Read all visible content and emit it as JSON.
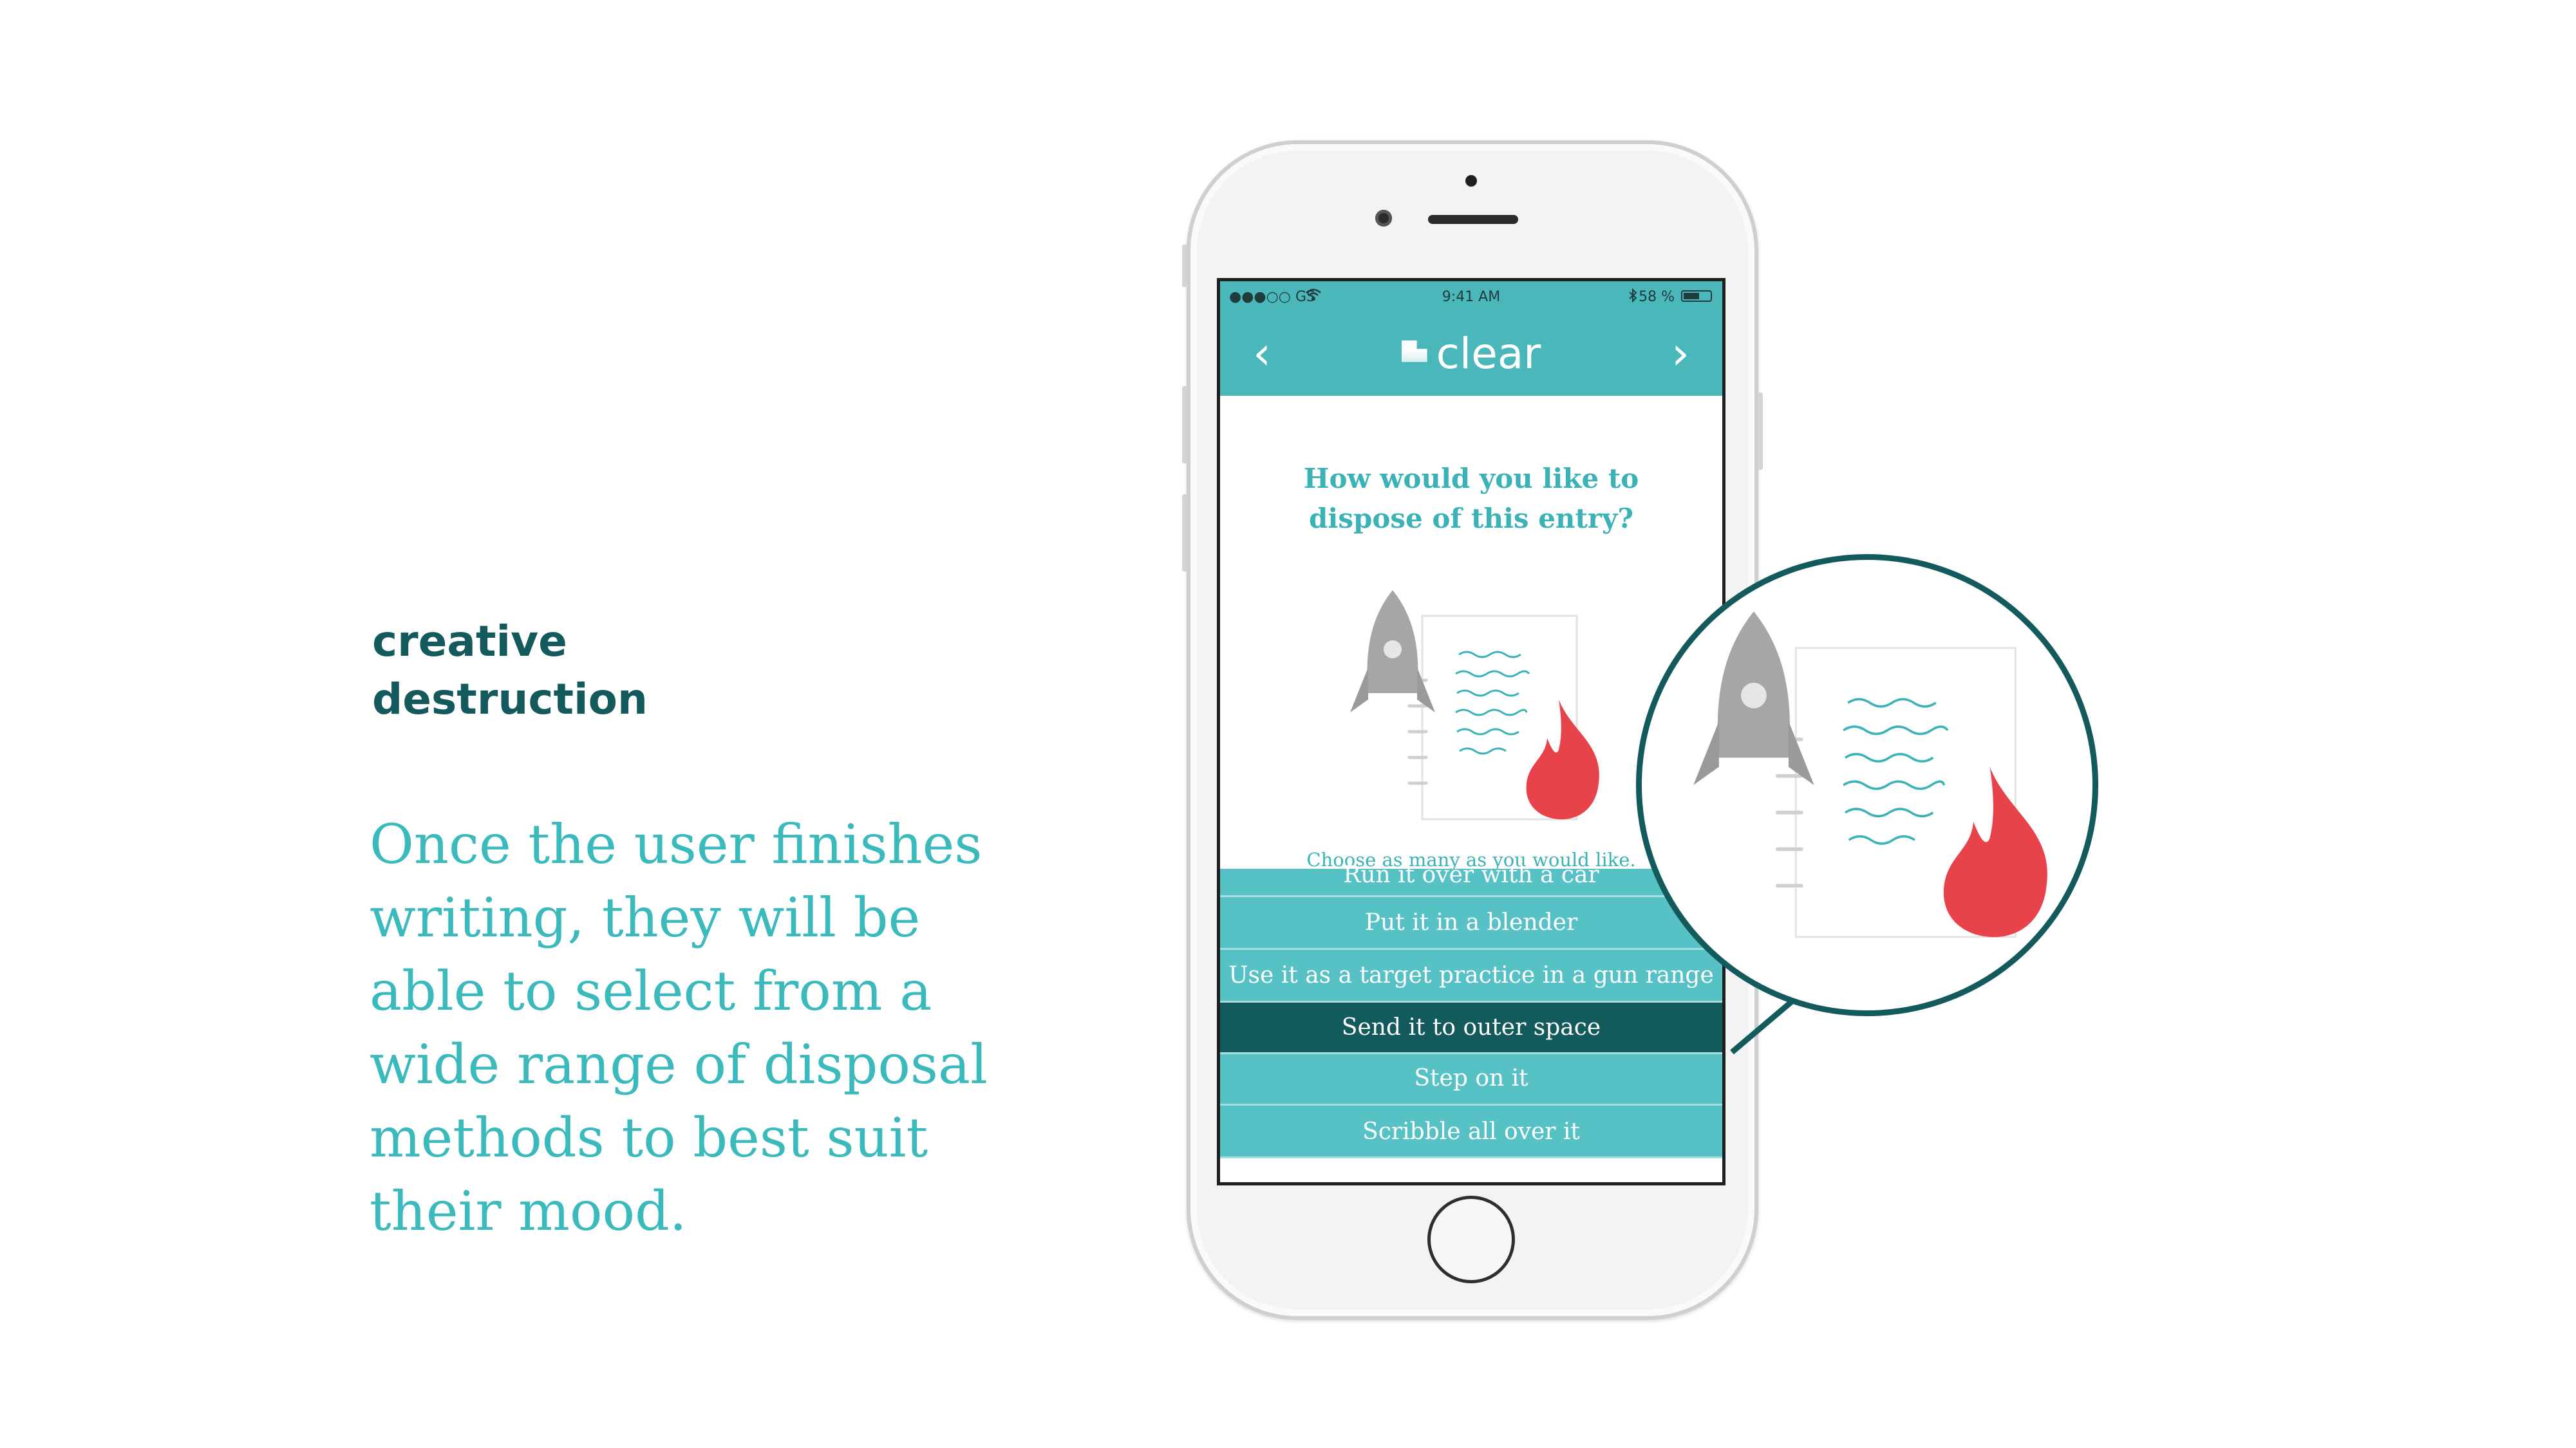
{
  "heading": {
    "line1": "creative",
    "line2": "destruction"
  },
  "body_copy": [
    "Once the user finishes",
    "writing, they will be",
    "able to select from a",
    "wide range of disposal",
    "methods to best suit",
    "their mood."
  ],
  "status_bar": {
    "carrier": "●●●○○ GS",
    "time": "9:41 AM",
    "battery": "58 %"
  },
  "nav": {
    "back_icon": "‹",
    "forward_icon": "›",
    "app_name": "clear"
  },
  "screen": {
    "question_line1": "How would you like to",
    "question_line2": "dispose of this entry?",
    "instruction": "Choose as many as you would like."
  },
  "options": [
    {
      "label": "Run it over with a car",
      "selected": false
    },
    {
      "label": "Put it in a blender",
      "selected": false
    },
    {
      "label": "Use it as a target practice in a gun range",
      "selected": false
    },
    {
      "label": "Send it to outer space",
      "selected": true
    },
    {
      "label": "Step on it",
      "selected": false
    },
    {
      "label": "Scribble all over it",
      "selected": false
    }
  ],
  "icons": {
    "rocket": "rocket-icon",
    "paper": "paper-icon",
    "flame": "flame-icon"
  },
  "colors": {
    "brand_teal": "#4ab7bb",
    "option_teal": "#57c2c5",
    "selected_dark": "#135a5c",
    "heading": "#145a5c",
    "flame_red": "#e8424a"
  }
}
